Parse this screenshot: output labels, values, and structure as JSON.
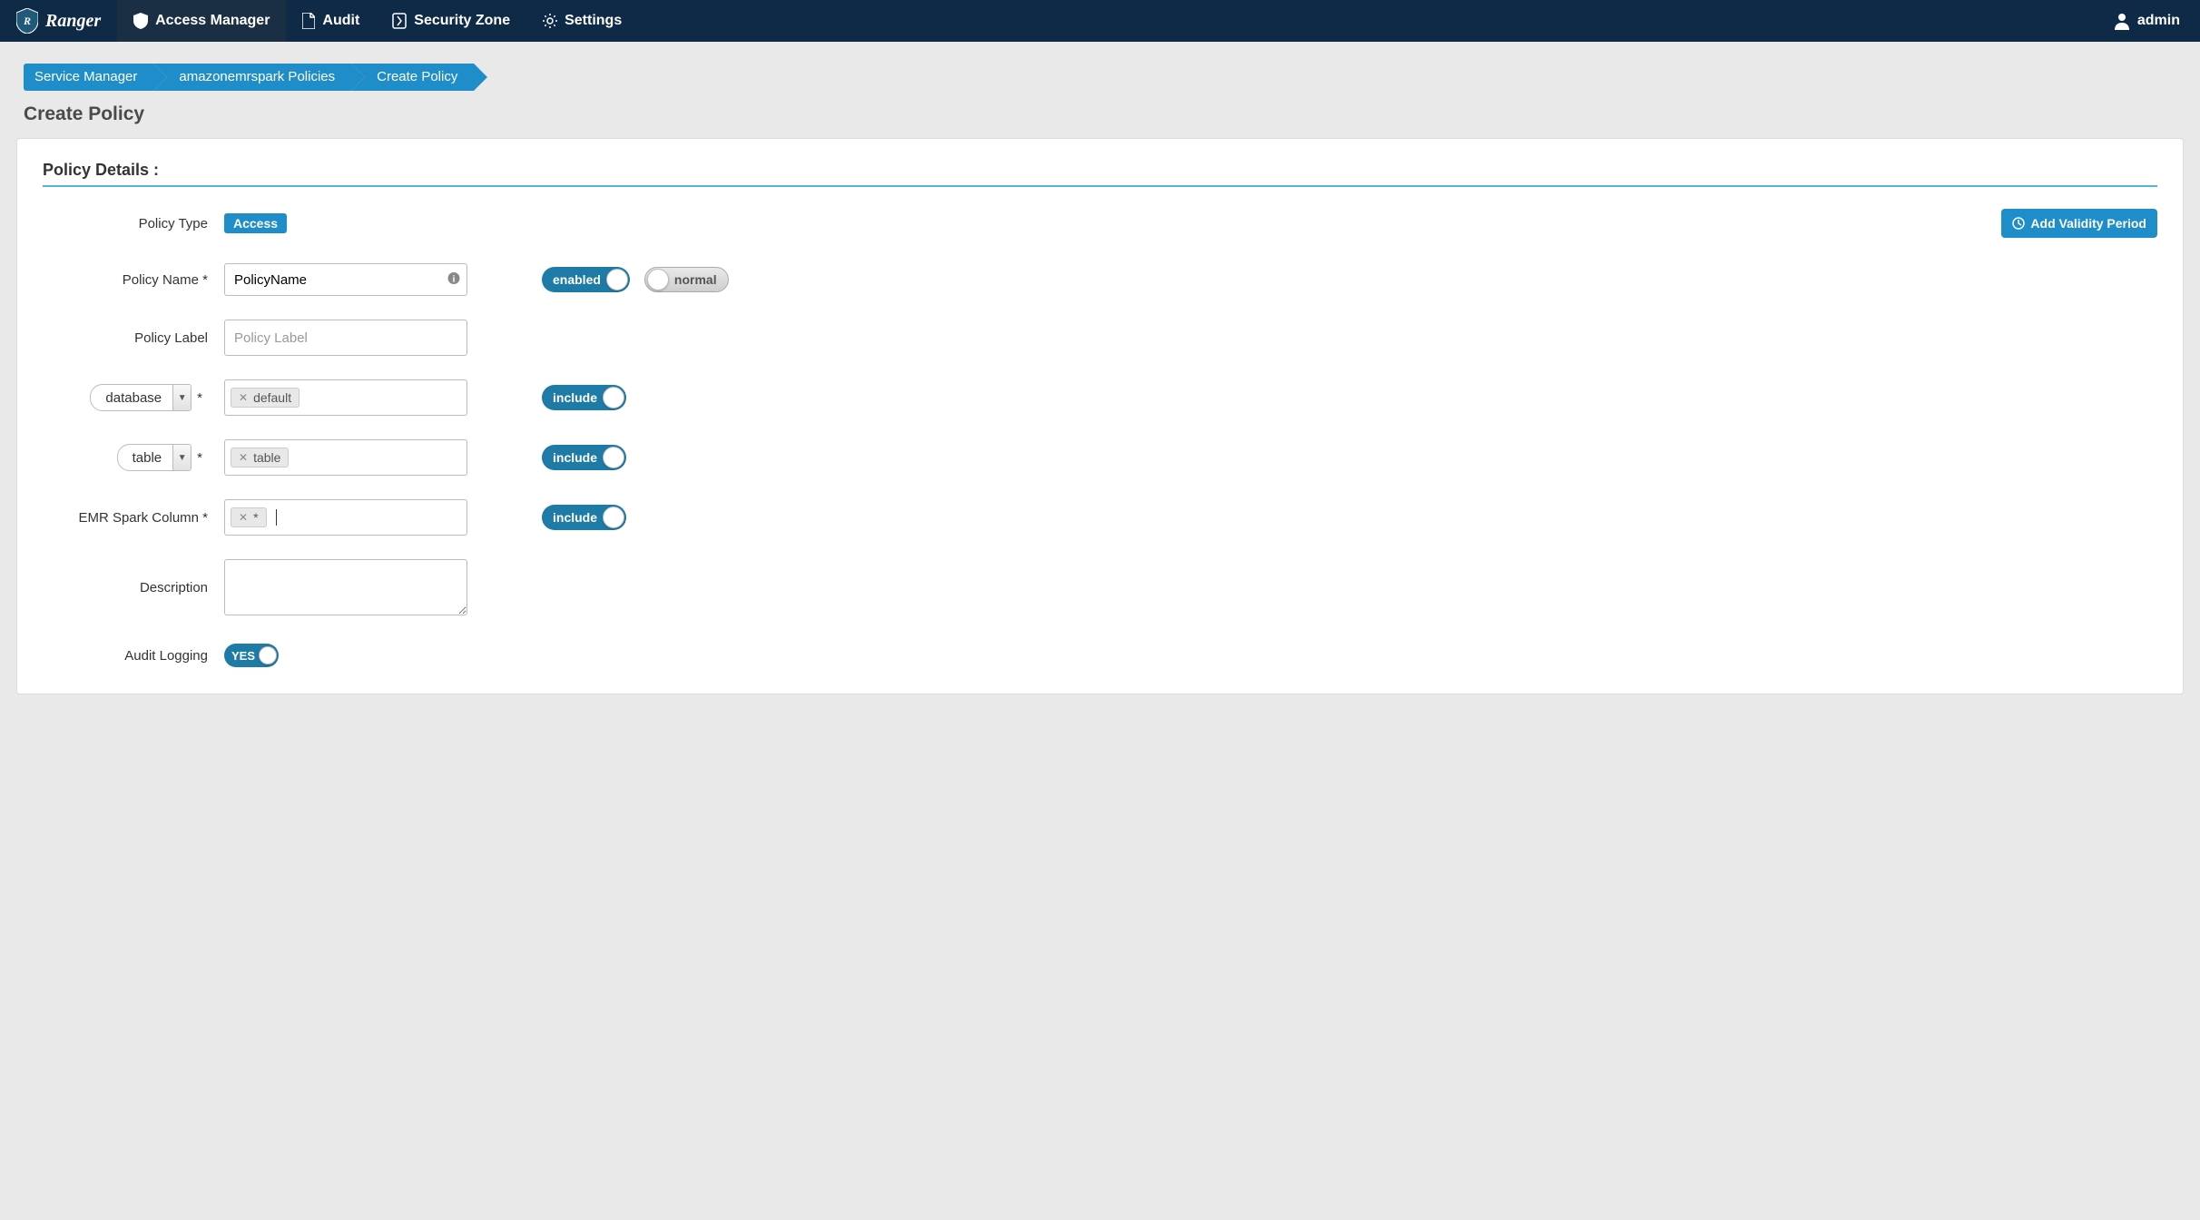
{
  "brand": "Ranger",
  "nav": {
    "access_manager": "Access Manager",
    "audit": "Audit",
    "security_zone": "Security Zone",
    "settings": "Settings",
    "user": "admin"
  },
  "breadcrumb": {
    "b1": "Service Manager",
    "b2": "amazonemrspark Policies",
    "b3": "Create Policy"
  },
  "page_title": "Create Policy",
  "section_title": "Policy Details :",
  "labels": {
    "policy_type": "Policy Type",
    "policy_name": "Policy Name *",
    "policy_label": "Policy Label",
    "database": "database",
    "table": "table",
    "emr_spark_column": "EMR Spark Column *",
    "description": "Description",
    "audit_logging": "Audit Logging"
  },
  "values": {
    "policy_type_badge": "Access",
    "policy_name": "PolicyName",
    "policy_label_placeholder": "Policy Label",
    "database_tag": "default",
    "table_tag": "table",
    "column_tag": "*"
  },
  "toggles": {
    "enabled": "enabled",
    "normal": "normal",
    "include": "include",
    "yes": "YES"
  },
  "buttons": {
    "add_validity": "Add Validity Period"
  }
}
